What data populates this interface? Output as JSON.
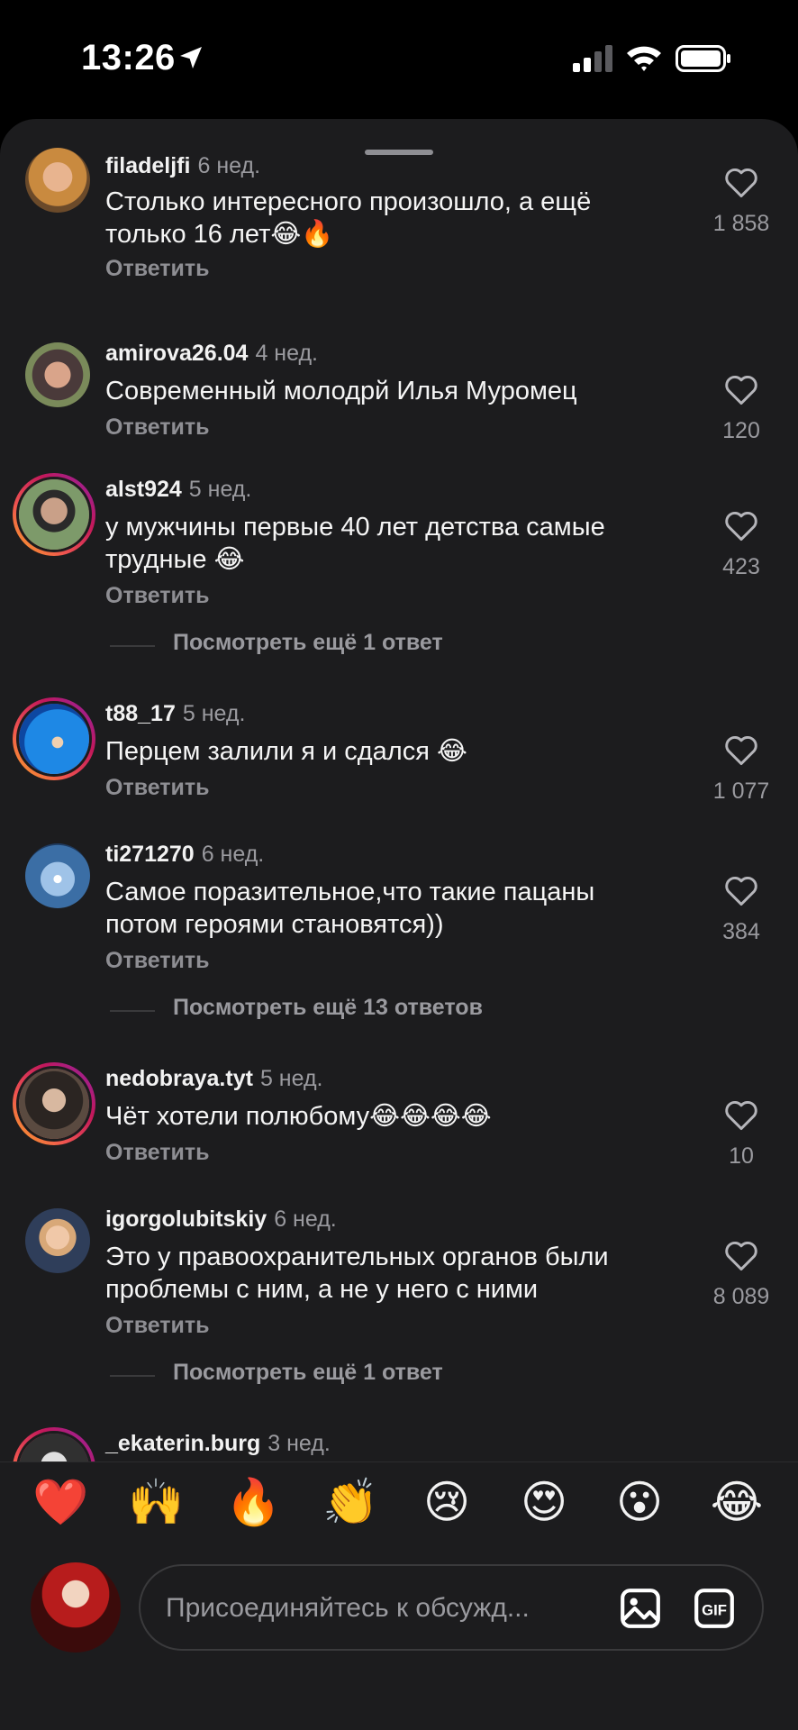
{
  "status_bar": {
    "time": "13:26"
  },
  "comments": [
    {
      "username": "filadeljfi",
      "age": "6 нед.",
      "text": "Столько интересного произошло, а ещё только 16 лет😂🔥",
      "reply": "Ответить",
      "likes": "1 858",
      "more": ""
    },
    {
      "username": "amirova26.04",
      "age": "4 нед.",
      "text": "Современный молодрй Илья Муромец",
      "reply": "Ответить",
      "likes": "120",
      "more": ""
    },
    {
      "username": "alst924",
      "age": "5 нед.",
      "text": "у мужчины первые 40 лет детства самые трудные 😂",
      "reply": "Ответить",
      "likes": "423",
      "more": "Посмотреть ещё 1 ответ"
    },
    {
      "username": "t88_17",
      "age": "5 нед.",
      "text": "Перцем залили я и сдался 😂",
      "reply": "Ответить",
      "likes": "1 077",
      "more": ""
    },
    {
      "username": "ti271270",
      "age": "6 нед.",
      "text": "Самое поразительное,что такие пацаны потом героями становятся))",
      "reply": "Ответить",
      "likes": "384",
      "more": "Посмотреть ещё 13 ответов"
    },
    {
      "username": "nedobraya.tyt",
      "age": "5 нед.",
      "text": "Чёт хотели полюбому😂😂😂😂",
      "reply": "Ответить",
      "likes": "10",
      "more": ""
    },
    {
      "username": "igorgolubitskiy",
      "age": "6 нед.",
      "text": "Это у правоохранительных органов были проблемы с ним, а не у него с ними",
      "reply": "Ответить",
      "likes": "8 089",
      "more": "Посмотреть ещё 1 ответ"
    },
    {
      "username": "_ekaterin.burg",
      "age": "3 нед.",
      "text": "",
      "reply": "",
      "likes": "",
      "more": ""
    }
  ],
  "emoji_bar": [
    "❤️",
    "🙌",
    "🔥",
    "👏",
    "😢",
    "😍",
    "😮",
    "😂"
  ],
  "composer": {
    "placeholder": "Присоединяйтесь к обсужд..."
  },
  "colors": {
    "background": "#1c1c1e",
    "ring_gradient": [
      "#f9a825",
      "#ef5350",
      "#c2185b",
      "#8e24aa"
    ]
  }
}
